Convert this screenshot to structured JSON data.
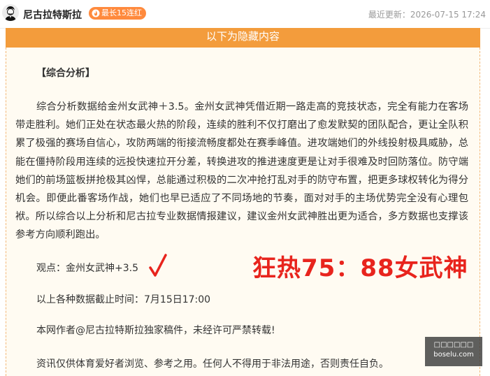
{
  "header": {
    "author": "尼古拉特斯拉",
    "streak_badge": "最长15连红",
    "updated": "最近更新：2026-07-15 17:24"
  },
  "hidden_banner": "以下为隐藏内容",
  "article": {
    "section_title": "【综合分析】",
    "paragraph": "综合分析数据给金州女武神＋3.5。金州女武神凭借近期一路走高的竞技状态，完全有能力在客场带走胜利。她们正处在状态最火热的阶段，连续的胜利不仅打磨出了愈发默契的团队配合，更让全队积累了极强的赛场自信心，攻防两端的衔接流畅度都处在赛季峰值。进攻端她们的外线投射极具威胁，总能在僵持阶段用连续的远投快速拉开分差，转换进攻的推进速度更是让对手很难及时回防落位。防守端她们的前场篮板拼抢极其凶悍，总能通过积极的二次冲抢打乱对手的防守布置，把更多球权转化为得分机会。即便此番客场作战，她们也早已适应了不同场地的节奏，面对对手的主场优势完全没有心理包袱。所以综合以上分析和尼古拉专业数据情报建议，建议金州女武神胜出更为适合，多方数据也支撑该参考方向顺利跑出。",
    "viewpoint": "观点：金州女武神+3.5",
    "big_pick": "狂热75：88女武神",
    "cutoff": "以上各种数据截止时间：7月15日17:00",
    "copyright": "本网作者@尼古拉特斯拉独家稿件，未经许可严禁转载!",
    "disclaimer": "资讯仅供体育爱好者浏览、参考之用。任何人不得用于非法用途，否则责任自负。"
  },
  "watermark": {
    "line1": "□□□□□□",
    "line2": "boselu.com"
  },
  "colors": {
    "accent": "#f39c3c",
    "pick_red": "#e8241d",
    "content_bg": "#fffbf2"
  }
}
